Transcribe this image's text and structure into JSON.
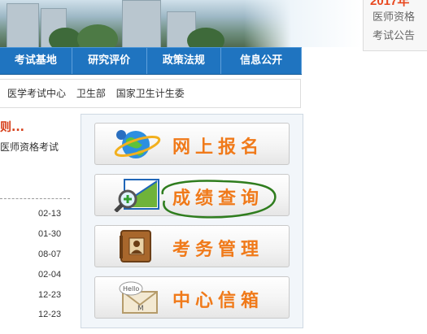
{
  "notice": {
    "year_fragment": "2017年",
    "line1": "医师资格",
    "line2": "考试公告"
  },
  "nav": {
    "items": [
      {
        "label": "考试基地"
      },
      {
        "label": "研究评价"
      },
      {
        "label": "政策法规"
      },
      {
        "label": "信息公开"
      }
    ]
  },
  "links": {
    "items": [
      "医学考试中心",
      "卫生部",
      "国家卫生计生委"
    ]
  },
  "left": {
    "title": "则...",
    "subtitle": "医师资格考试"
  },
  "dates": [
    "02-13",
    "01-30",
    "08-07",
    "02-04",
    "12-23",
    "12-23"
  ],
  "services": [
    {
      "label": "网上报名",
      "icon": "globe-icon"
    },
    {
      "label": "成绩查询",
      "icon": "magnifier-chart-icon"
    },
    {
      "label": "考务管理",
      "icon": "wallet-icon"
    },
    {
      "label": "中心信箱",
      "icon": "mail-icon"
    }
  ],
  "colors": {
    "nav_blue": "#1f74c0",
    "accent_orange": "#f07a1a",
    "title_red": "#d53a14",
    "annotation_green": "#2f7d1e"
  }
}
